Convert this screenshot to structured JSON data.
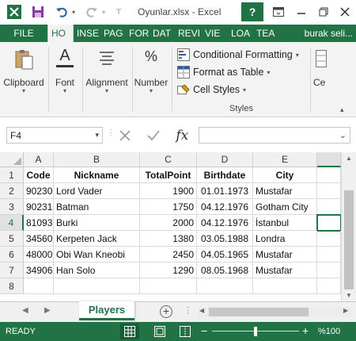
{
  "window": {
    "title": "Oyunlar.xlsx - Excel",
    "help": "?"
  },
  "tabs": [
    {
      "label": "FILE"
    },
    {
      "label": "HO"
    },
    {
      "label": "INSE"
    },
    {
      "label": "PAG"
    },
    {
      "label": "FOR"
    },
    {
      "label": "DAT"
    },
    {
      "label": "REVI"
    },
    {
      "label": "VIE"
    },
    {
      "label": "LOA"
    },
    {
      "label": "TEA"
    },
    {
      "label": "burak seli..."
    }
  ],
  "ribbon": {
    "clipboard": "Clipboard",
    "font": "Font",
    "alignment": "Alignment",
    "number": "Number",
    "conditional_formatting": "Conditional Formatting",
    "format_as_table": "Format as Table",
    "cell_styles": "Cell Styles",
    "styles_group": "Styles",
    "cells_partial": "Ce",
    "font_letter": "A",
    "percent": "%"
  },
  "formula_bar": {
    "name_box": "F4",
    "fx": "fx",
    "formula": ""
  },
  "grid": {
    "columns": [
      "A",
      "B",
      "C",
      "D",
      "E"
    ],
    "rows": [
      "1",
      "2",
      "3",
      "4",
      "5",
      "6",
      "7",
      "8"
    ],
    "header": [
      "Code",
      "Nickname",
      "TotalPoint",
      "Birthdate",
      "City"
    ],
    "data": [
      [
        "90230",
        "Lord Vader",
        "1900",
        "01.01.1973",
        "Mustafar"
      ],
      [
        "90231",
        "Batman",
        "1750",
        "04.12.1976",
        "Gotham City"
      ],
      [
        "81093",
        "Burki",
        "2000",
        "04.12.1976",
        "İstanbul"
      ],
      [
        "34560",
        "Kerpeten Jack",
        "1380",
        "03.05.1988",
        "Londra"
      ],
      [
        "48000",
        "Obi Wan Kneobi",
        "2450",
        "04.05.1965",
        "Mustafar"
      ],
      [
        "34906",
        "Han Solo",
        "1290",
        "08.05.1968",
        "Mustafar"
      ]
    ]
  },
  "sheets": {
    "active": "Players",
    "add": "+"
  },
  "status": {
    "ready": "READY",
    "zoom": "%100",
    "minus": "−",
    "plus": "+"
  },
  "colors": {
    "accent": "#217346",
    "status_active": "#185c37"
  }
}
